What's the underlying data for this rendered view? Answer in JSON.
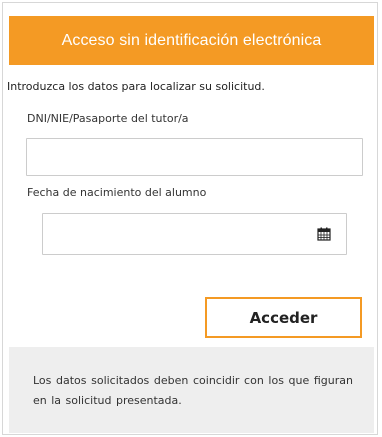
{
  "header": {
    "title": "Acceso sin identificación electrónica",
    "bg_color": "#f49a24"
  },
  "form": {
    "intro": "Introduzca los datos para localizar su solicitud.",
    "dni_label": "DNI/NIE/Pasaporte del tutor/a",
    "dni_value": "",
    "fecha_label": "Fecha de nacimiento del alumno",
    "fecha_value": "",
    "calendar_icon": "calendar-icon",
    "submit_label": "Acceder"
  },
  "footer": {
    "note": "Los datos solicitados deben coincidir con los que figuran en la solicitud presentada."
  }
}
